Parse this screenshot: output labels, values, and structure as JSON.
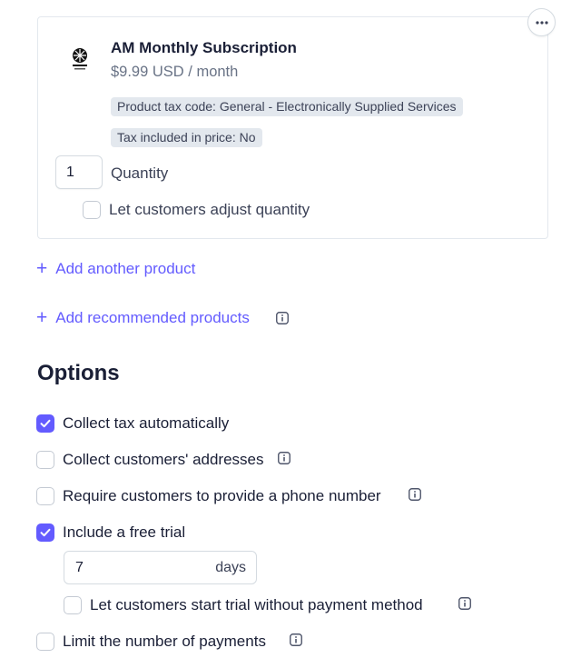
{
  "product": {
    "name": "AM Monthly Subscription",
    "price": "$9.99 USD / month",
    "tax_code_tag": "Product tax code: General - Electronically Supplied Services",
    "tax_included_tag": "Tax included in price: No",
    "quantity_value": "1",
    "quantity_label": "Quantity",
    "adjust_quantity_label": "Let customers adjust quantity",
    "adjust_quantity_checked": false
  },
  "links": {
    "add_product": "Add another product",
    "add_recommended": "Add recommended products"
  },
  "options": {
    "heading": "Options",
    "collect_tax": {
      "label": "Collect tax automatically",
      "checked": true
    },
    "collect_addresses": {
      "label": "Collect customers' addresses",
      "checked": false
    },
    "require_phone": {
      "label": "Require customers to provide a phone number",
      "checked": false
    },
    "free_trial": {
      "label": "Include a free trial",
      "checked": true,
      "days_value": "7",
      "days_unit": "days"
    },
    "trial_no_payment": {
      "label": "Let customers start trial without payment method",
      "checked": false
    },
    "limit_payments": {
      "label": "Limit the number of payments",
      "checked": false
    }
  },
  "colors": {
    "accent": "#635bff",
    "border": "#e3e8ee",
    "tag_bg": "#e3e8ee",
    "text": "#1a1f36",
    "muted": "#697386"
  }
}
